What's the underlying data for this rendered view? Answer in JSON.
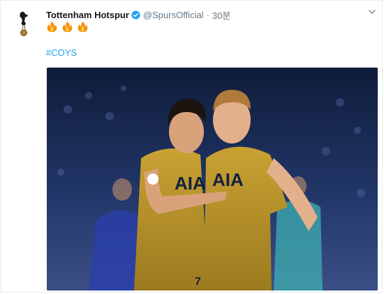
{
  "tweet": {
    "display_name": "Tottenham Hotspur",
    "handle": "@SpursOfficial",
    "separator": "·",
    "time": "30분",
    "emoji_text": "🔥 🔥 🔥",
    "hashtag": "#COYS",
    "verified_icon": "verified-badge-icon",
    "menu_icon": "chevron-down-icon",
    "accent_color": "#1da1f2"
  },
  "photo": {
    "shirt_text_left": "AIA",
    "shirt_text_right": "AIA",
    "number_left": "7"
  }
}
